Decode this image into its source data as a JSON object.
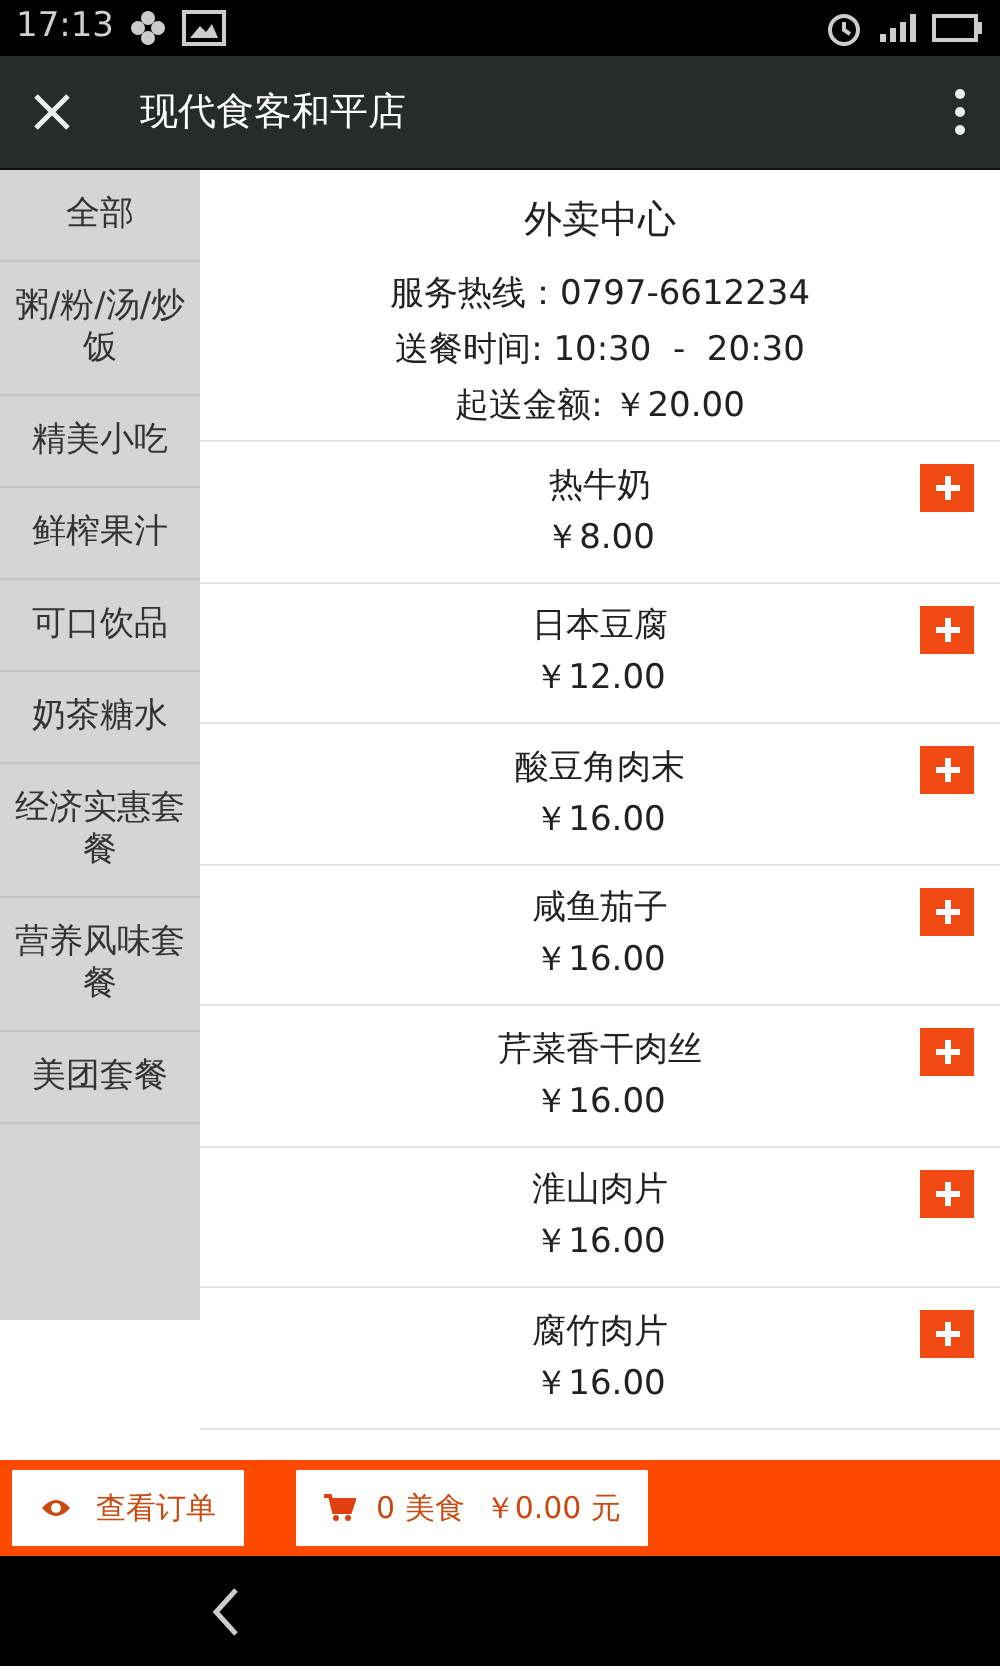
{
  "status_bar": {
    "time": "17:13"
  },
  "header": {
    "title": "现代食客和平店"
  },
  "sidebar": {
    "items": [
      {
        "label": "全部"
      },
      {
        "label": "粥/粉/汤/炒饭"
      },
      {
        "label": "精美小吃"
      },
      {
        "label": "鲜榨果汁"
      },
      {
        "label": "可口饮品"
      },
      {
        "label": "奶茶糖水"
      },
      {
        "label": "经济实惠套餐"
      },
      {
        "label": "营养风味套餐"
      },
      {
        "label": "美团套餐"
      }
    ]
  },
  "info": {
    "title": "外卖中心",
    "lines": [
      "服务热线：0797-6612234",
      "送餐时间: 10:30  -  20:30",
      "起送金额: ￥20.00"
    ]
  },
  "menu_items": [
    {
      "name": "热牛奶",
      "price": "￥8.00"
    },
    {
      "name": "日本豆腐",
      "price": "￥12.00"
    },
    {
      "name": "酸豆角肉末",
      "price": "￥16.00"
    },
    {
      "name": "咸鱼茄子",
      "price": "￥16.00"
    },
    {
      "name": "芹菜香干肉丝",
      "price": "￥16.00"
    },
    {
      "name": "淮山肉片",
      "price": "￥16.00"
    },
    {
      "name": "腐竹肉片",
      "price": "￥16.00"
    }
  ],
  "bottom_bar": {
    "orders_button": "查看订单",
    "cart_count": "0 美食",
    "cart_total": "￥0.00 元"
  }
}
